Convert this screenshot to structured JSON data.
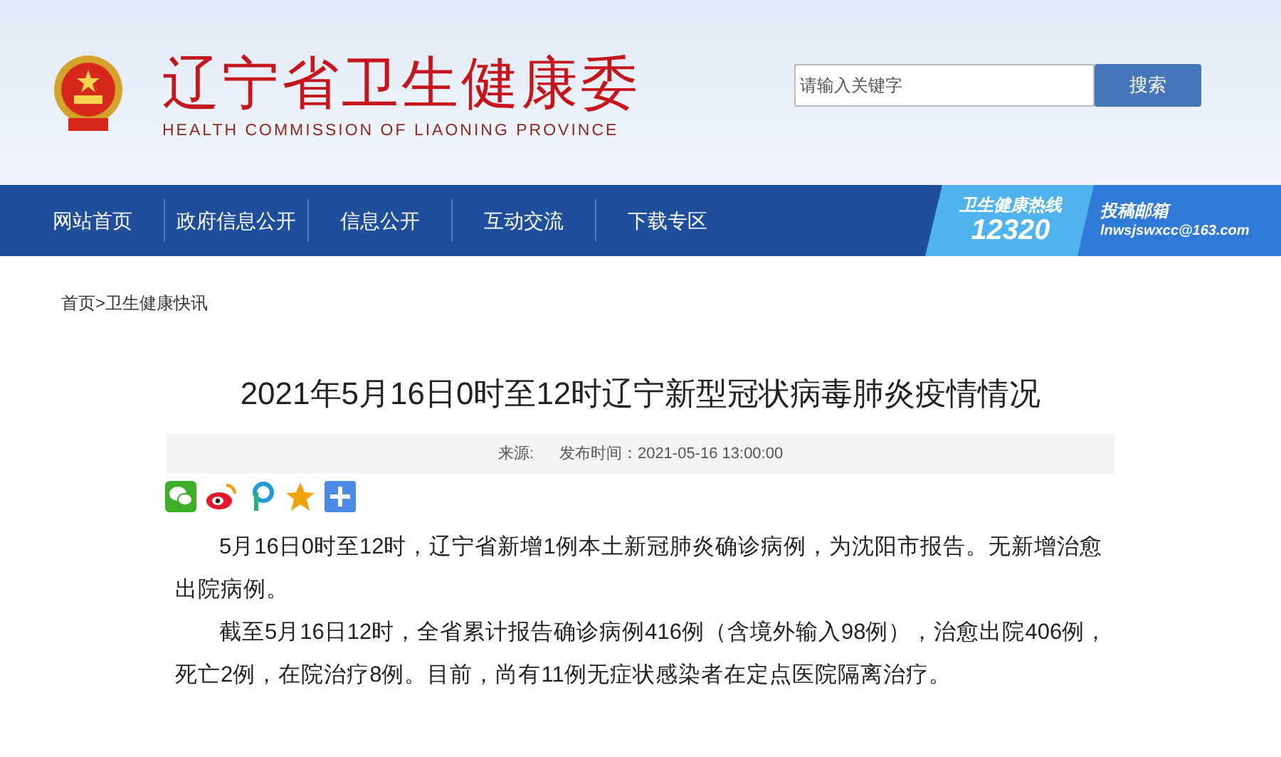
{
  "header": {
    "title": "辽宁省卫生健康委",
    "subtitle": "HEALTH COMMISSION OF LIAONING PROVINCE"
  },
  "search": {
    "placeholder": "请输入关键字",
    "button": "搜索"
  },
  "nav": {
    "items": [
      {
        "label": "网站首页"
      },
      {
        "label": "政府信息公开"
      },
      {
        "label": "信息公开"
      },
      {
        "label": "互动交流"
      },
      {
        "label": "下载专区"
      }
    ],
    "hotline": {
      "label": "卫生健康热线",
      "number": "12320"
    },
    "mailbox": {
      "label": "投稿邮箱",
      "address": "lnwsjswxcc@163.com"
    }
  },
  "breadcrumb": "首页>卫生健康快讯",
  "article": {
    "title": "2021年5月16日0时至12时辽宁新型冠状病毒肺炎疫情情况",
    "source_label": "来源:",
    "published": "发布时间：2021-05-16 13:00:00",
    "share_icons": [
      {
        "kind": "wechat"
      },
      {
        "kind": "weibo"
      },
      {
        "kind": "pinterest"
      },
      {
        "kind": "qzone"
      },
      {
        "kind": "more"
      }
    ],
    "paragraphs": [
      "5月16日0时至12时，辽宁省新增1例本土新冠肺炎确诊病例，为沈阳市报告。无新增治愈出院病例。",
      "截至5月16日12时，全省累计报告确诊病例416例（含境外输入98例），治愈出院406例，死亡2例，在院治疗8例。目前，尚有11例无症状感染者在定点医院隔离治疗。"
    ]
  }
}
